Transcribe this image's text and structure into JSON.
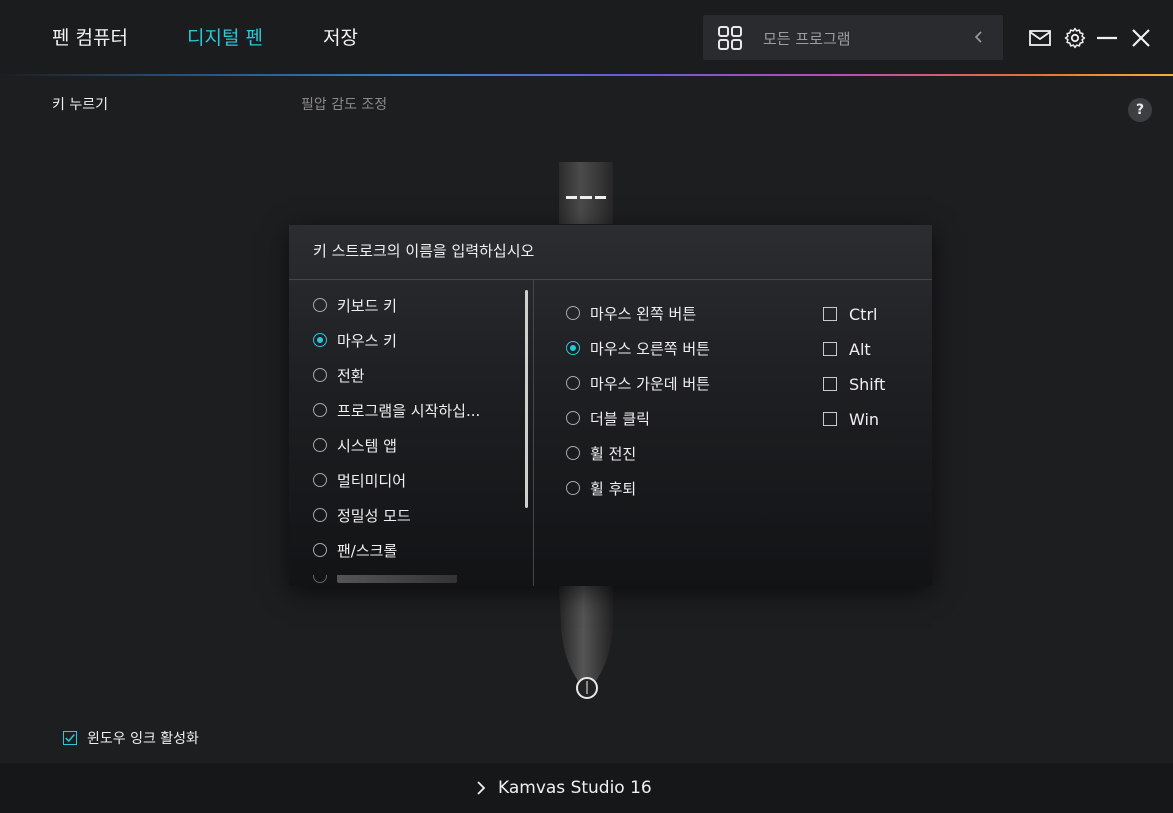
{
  "header": {
    "tabs": [
      {
        "label": "펜 컴퓨터",
        "active": false
      },
      {
        "label": "디지털 펜",
        "active": true
      },
      {
        "label": "저장",
        "active": false
      }
    ],
    "program_selector": {
      "label": "모든 프로그램",
      "icon": "app-grid-icon"
    },
    "icons": [
      "mail-icon",
      "settings-gear-icon",
      "minimize-icon",
      "close-icon"
    ]
  },
  "subheader": {
    "tabs": [
      {
        "label": "키 누르기",
        "active": true
      },
      {
        "label": "필압 감도 조정",
        "active": false
      }
    ],
    "help_label": "?"
  },
  "dialog": {
    "title": "키 스트로크의 이름을 입력하십시오",
    "categories": [
      {
        "label": "키보드 키",
        "selected": false
      },
      {
        "label": "마우스 키",
        "selected": true
      },
      {
        "label": "전환",
        "selected": false
      },
      {
        "label": "프로그램을 시작하십...",
        "selected": false
      },
      {
        "label": "시스템 앱",
        "selected": false
      },
      {
        "label": "멀티미디어",
        "selected": false
      },
      {
        "label": "정밀성 모드",
        "selected": false
      },
      {
        "label": "팬/스크롤",
        "selected": false
      }
    ],
    "mouse_keys": [
      {
        "label": "마우스 왼쪽 버튼",
        "selected": false
      },
      {
        "label": "마우스 오른쪽 버튼",
        "selected": true
      },
      {
        "label": "마우스 가운데 버튼",
        "selected": false
      },
      {
        "label": "더블 클릭",
        "selected": false
      },
      {
        "label": "휠 전진",
        "selected": false
      },
      {
        "label": "휠 후퇴",
        "selected": false
      }
    ],
    "modifiers": [
      {
        "label": "Ctrl",
        "checked": false
      },
      {
        "label": "Alt",
        "checked": false
      },
      {
        "label": "Shift",
        "checked": false
      },
      {
        "label": "Win",
        "checked": false
      }
    ]
  },
  "footer": {
    "windows_ink_label": "윈도우 잉크 활성화",
    "windows_ink_checked": true,
    "device_name": "Kamvas Studio 16"
  },
  "colors": {
    "accent": "#2bc6d9",
    "background": "#1d1e20"
  }
}
